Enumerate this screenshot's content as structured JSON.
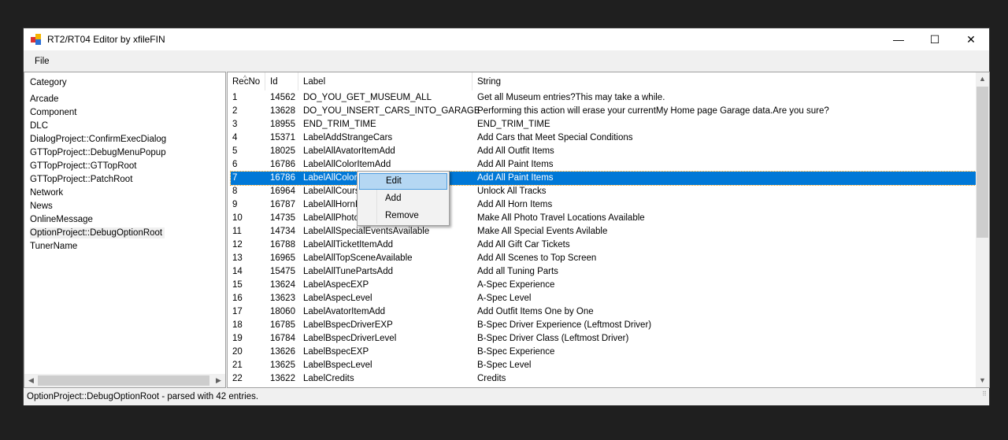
{
  "window": {
    "title": "RT2/RT04 Editor by xfileFIN",
    "minimize": "—",
    "maximize": "☐",
    "close": "✕"
  },
  "menu": {
    "file": "File"
  },
  "category": {
    "header": "Category",
    "items": [
      "Arcade",
      "Component",
      "DLC",
      "DialogProject::ConfirmExecDialog",
      "GTTopProject::DebugMenuPopup",
      "GTTopProject::GTTopRoot",
      "GTTopProject::PatchRoot",
      "Network",
      "News",
      "OnlineMessage",
      "OptionProject::DebugOptionRoot",
      "TunerName"
    ],
    "selected_index": 10
  },
  "table": {
    "columns": [
      "RecNo",
      "Id",
      "Label",
      "String"
    ],
    "selected_index": 6,
    "rows": [
      [
        "1",
        "14562",
        "DO_YOU_GET_MUSEUM_ALL",
        "Get all Museum entries?This may take a while."
      ],
      [
        "2",
        "13628",
        "DO_YOU_INSERT_CARS_INTO_GARAGE",
        "Performing this action will erase your currentMy Home page Garage data.Are you sure?"
      ],
      [
        "3",
        "18955",
        "END_TRIM_TIME",
        "END_TRIM_TIME"
      ],
      [
        "4",
        "15371",
        "LabelAddStrangeCars",
        "Add Cars that Meet Special Conditions"
      ],
      [
        "5",
        "18025",
        "LabelAllAvatorItemAdd",
        "Add All Outfit Items"
      ],
      [
        "6",
        "16786",
        "LabelAllColorItemAdd",
        "Add All Paint Items"
      ],
      [
        "7",
        "16786",
        "LabelAllColorIte",
        "Add All Paint Items"
      ],
      [
        "8",
        "16964",
        "LabelAllCourse",
        "Unlock All Tracks"
      ],
      [
        "9",
        "16787",
        "LabelAllHornIte",
        "Add All Horn Items"
      ],
      [
        "10",
        "14735",
        "LabelAllPhotoL",
        "Make All Photo Travel Locations Available"
      ],
      [
        "11",
        "14734",
        "LabelAllSpecialEventsAvailable",
        "Make All Special Events Avilable"
      ],
      [
        "12",
        "16788",
        "LabelAllTicketItemAdd",
        "Add All Gift Car Tickets"
      ],
      [
        "13",
        "16965",
        "LabelAllTopSceneAvailable",
        "Add All Scenes to Top Screen"
      ],
      [
        "14",
        "15475",
        "LabelAllTunePartsAdd",
        "Add all Tuning Parts"
      ],
      [
        "15",
        "13624",
        "LabelAspecEXP",
        "A-Spec Experience"
      ],
      [
        "16",
        "13623",
        "LabelAspecLevel",
        "A-Spec Level"
      ],
      [
        "17",
        "18060",
        "LabelAvatorItemAdd",
        "Add Outfit Items One by One"
      ],
      [
        "18",
        "16785",
        "LabelBspecDriverEXP",
        "B-Spec Driver Experience (Leftmost Driver)"
      ],
      [
        "19",
        "16784",
        "LabelBspecDriverLevel",
        "B-Spec Driver Class (Leftmost Driver)"
      ],
      [
        "20",
        "13626",
        "LabelBspecEXP",
        "B-Spec Experience"
      ],
      [
        "21",
        "13625",
        "LabelBspecLevel",
        "B-Spec Level"
      ],
      [
        "22",
        "13622",
        "LabelCredits",
        "Credits"
      ]
    ]
  },
  "context_menu": {
    "items": [
      "Edit",
      "Add",
      "Remove"
    ],
    "highlighted": 0
  },
  "status": "OptionProject::DebugOptionRoot - parsed with 42 entries.",
  "colors": {
    "selection": "#0078d7",
    "menu_highlight": "#b5d7f3"
  }
}
